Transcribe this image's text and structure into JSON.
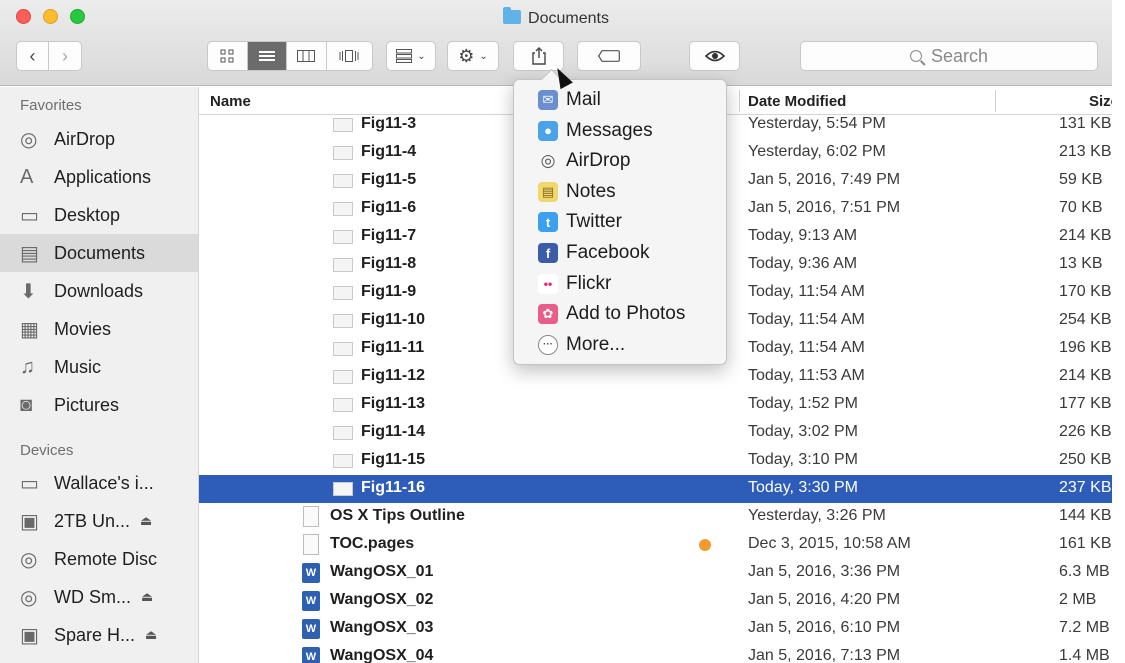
{
  "window": {
    "title": "Documents"
  },
  "toolbar": {
    "back_icon": "chevron-left-icon",
    "forward_icon": "chevron-right-icon",
    "view_modes": [
      "icon-view-icon",
      "list-view-icon",
      "column-view-icon",
      "coverflow-view-icon"
    ],
    "active_view": "list-view-icon",
    "search_placeholder": "Search"
  },
  "sidebar": {
    "favorites_heading": "Favorites",
    "favorites": [
      {
        "label": "AirDrop",
        "icon": "airdrop-icon"
      },
      {
        "label": "Applications",
        "icon": "applications-icon"
      },
      {
        "label": "Desktop",
        "icon": "desktop-icon"
      },
      {
        "label": "Documents",
        "icon": "documents-icon",
        "selected": true
      },
      {
        "label": "Downloads",
        "icon": "downloads-icon"
      },
      {
        "label": "Movies",
        "icon": "movies-icon"
      },
      {
        "label": "Music",
        "icon": "music-icon"
      },
      {
        "label": "Pictures",
        "icon": "pictures-icon"
      }
    ],
    "devices_heading": "Devices",
    "devices": [
      {
        "label": "Wallace's i...",
        "icon": "computer-icon"
      },
      {
        "label": "2TB Un...",
        "icon": "drive-icon",
        "eject": "⏏"
      },
      {
        "label": "Remote Disc",
        "icon": "disc-icon"
      },
      {
        "label": "WD Sm...",
        "icon": "disc-icon",
        "eject": "⏏"
      },
      {
        "label": "Spare H...",
        "icon": "drive-icon",
        "eject": "⏏"
      }
    ]
  },
  "columns": {
    "name": "Name",
    "date": "Date Modified",
    "size": "Size"
  },
  "files": [
    {
      "name": "Fig11-3",
      "date": "Yesterday, 5:54 PM",
      "size": "131 KB"
    },
    {
      "name": "Fig11-4",
      "date": "Yesterday, 6:02 PM",
      "size": "213 KB"
    },
    {
      "name": "Fig11-5",
      "date": "Jan 5, 2016, 7:49 PM",
      "size": "59 KB"
    },
    {
      "name": "Fig11-6",
      "date": "Jan 5, 2016, 7:51 PM",
      "size": "70 KB"
    },
    {
      "name": "Fig11-7",
      "date": "Today, 9:13 AM",
      "size": "214 KB"
    },
    {
      "name": "Fig11-8",
      "date": "Today, 9:36 AM",
      "size": "13 KB"
    },
    {
      "name": "Fig11-9",
      "date": "Today, 11:54 AM",
      "size": "170 KB"
    },
    {
      "name": "Fig11-10",
      "date": "Today, 11:54 AM",
      "size": "254 KB"
    },
    {
      "name": "Fig11-11",
      "date": "Today, 11:54 AM",
      "size": "196 KB"
    },
    {
      "name": "Fig11-12",
      "date": "Today, 11:53 AM",
      "size": "214 KB"
    },
    {
      "name": "Fig11-13",
      "date": "Today, 1:52 PM",
      "size": "177 KB"
    },
    {
      "name": "Fig11-14",
      "date": "Today, 3:02 PM",
      "size": "226 KB"
    },
    {
      "name": "Fig11-15",
      "date": "Today, 3:10 PM",
      "size": "250 KB"
    },
    {
      "name": "Fig11-16",
      "date": "Today, 3:30 PM",
      "size": "237 KB",
      "selected": true
    },
    {
      "name": "OS X Tips Outline",
      "date": "Yesterday, 3:26 PM",
      "size": "144 KB",
      "kind": "doc"
    },
    {
      "name": "TOC.pages",
      "date": "Dec 3, 2015, 10:58 AM",
      "size": "161 KB",
      "kind": "doc",
      "tag_color": "#f39a2e"
    },
    {
      "name": "WangOSX_01",
      "date": "Jan 5, 2016, 3:36 PM",
      "size": "6.3 MB",
      "kind": "word"
    },
    {
      "name": "WangOSX_02",
      "date": "Jan 5, 2016, 4:20 PM",
      "size": "2 MB",
      "kind": "word"
    },
    {
      "name": "WangOSX_03",
      "date": "Jan 5, 2016, 6:10 PM",
      "size": "7.2 MB",
      "kind": "word"
    },
    {
      "name": "WangOSX_04",
      "date": "Jan 5, 2016, 7:13 PM",
      "size": "1.4 MB",
      "kind": "word"
    }
  ],
  "share_menu": {
    "items": [
      {
        "label": "Mail",
        "icon": "mail-icon",
        "color": "#6a8fd0"
      },
      {
        "label": "Messages",
        "icon": "messages-icon",
        "color": "#4aa3e8"
      },
      {
        "label": "AirDrop",
        "icon": "airdrop-icon",
        "color": "#8a8a8a"
      },
      {
        "label": "Notes",
        "icon": "notes-icon",
        "color": "#f2d76b"
      },
      {
        "label": "Twitter",
        "icon": "twitter-icon",
        "color": "#3ba1ee"
      },
      {
        "label": "Facebook",
        "icon": "facebook-icon",
        "color": "#3b5ca8"
      },
      {
        "label": "Flickr",
        "icon": "flickr-icon",
        "color": "#ffffff"
      },
      {
        "label": "Add to Photos",
        "icon": "photos-icon",
        "color": "#e85d8a"
      },
      {
        "label": "More...",
        "icon": "more-icon",
        "color": "#ffffff"
      }
    ]
  },
  "colors": {
    "selection": "#2d5db8",
    "sidebar_bg": "#f0f0f0",
    "toolbar_bg": "#dcdcdc"
  }
}
